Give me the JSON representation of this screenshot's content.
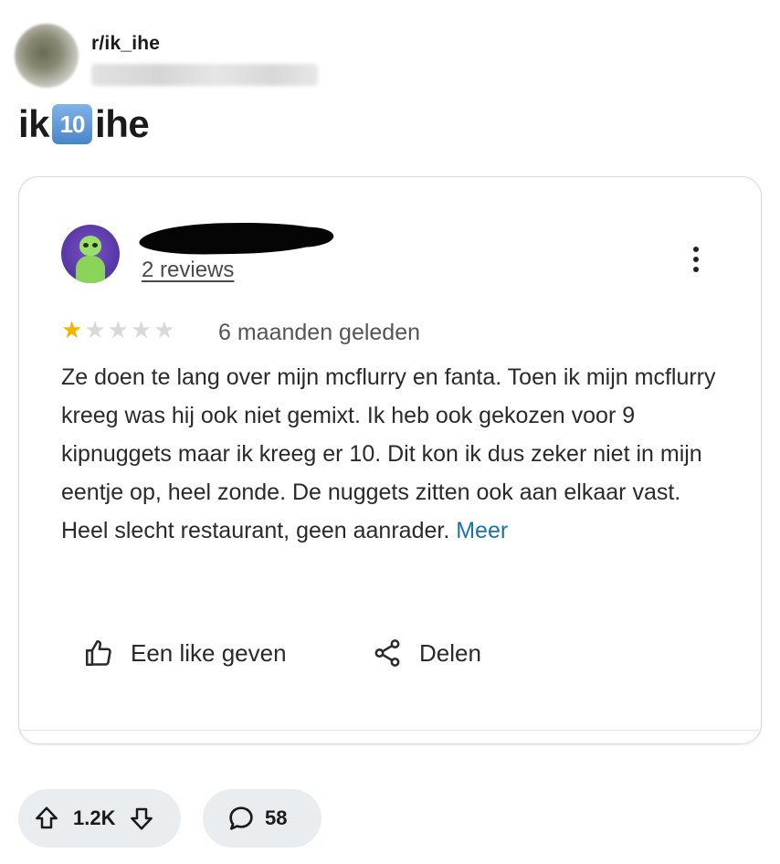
{
  "post": {
    "subreddit": "r/ik_ihe",
    "title_prefix": "ik",
    "title_keycap": "10",
    "title_suffix": "ihe"
  },
  "review": {
    "reviewer_review_count": "2 reviews",
    "rating": 1,
    "max_rating": 5,
    "date": "6 maanden geleden",
    "body": "Ze doen te lang over mijn  mcflurry en fanta. Toen ik mijn mcflurry kreeg was hij ook niet gemixt. Ik heb ook gekozen voor 9 kipnuggets maar ik kreeg er 10. Dit kon ik dus zeker niet in mijn eentje op, heel zonde.  De nuggets zitten ook aan elkaar vast. Heel slecht restaurant, geen aanrader.",
    "more_label": "Meer",
    "like_label": "Een like geven",
    "share_label": "Delen"
  },
  "footer": {
    "vote_count": "1.2K",
    "comment_count": "58"
  },
  "colors": {
    "star_filled": "#f4b400",
    "star_empty": "#d9d9d9",
    "link": "#1a73a8",
    "pill_bg": "#eaedef"
  },
  "icons": [
    "upvote-icon",
    "downvote-icon",
    "comment-icon",
    "thumbs-up-icon",
    "share-icon",
    "more-vert-icon"
  ]
}
